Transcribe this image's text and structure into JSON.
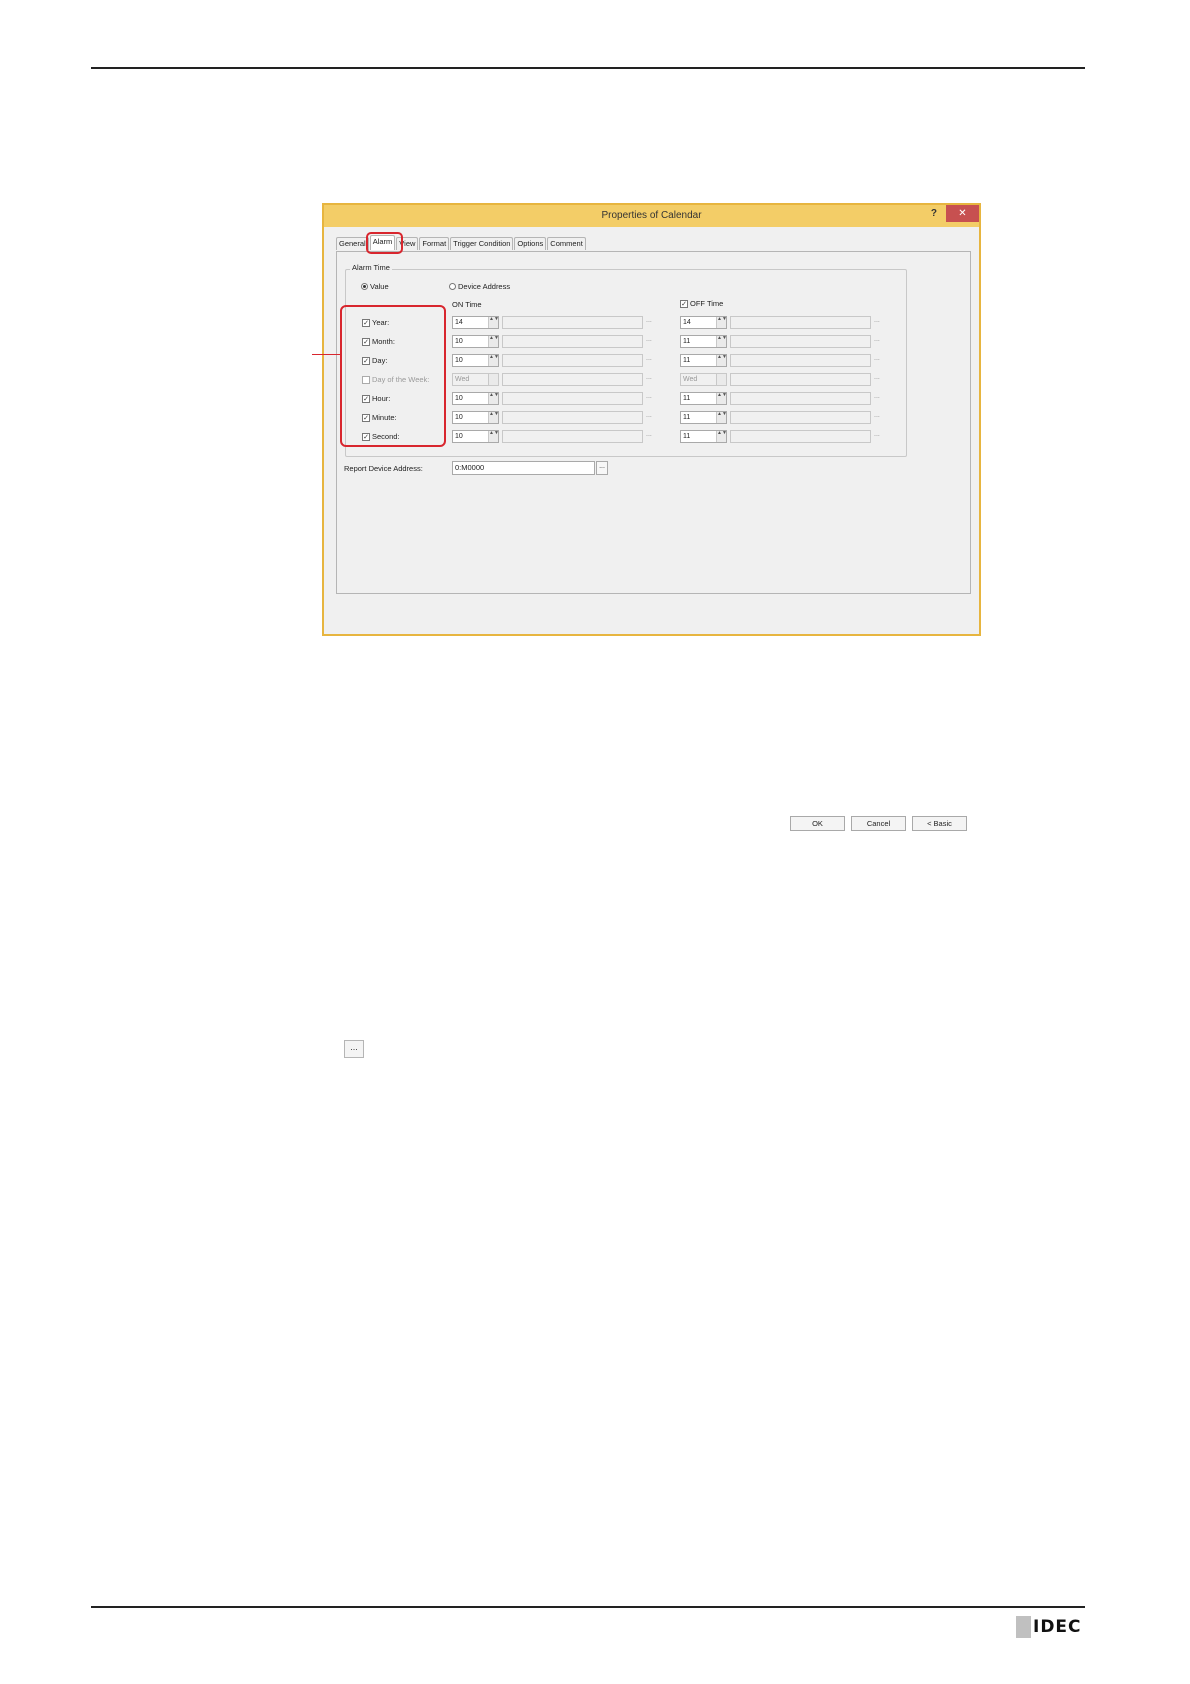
{
  "dialog": {
    "title": "Properties of Calendar",
    "help_label": "?",
    "close_label": "✕",
    "tabs": [
      {
        "label": "General",
        "active": false
      },
      {
        "label": "Alarm",
        "active": true
      },
      {
        "label": "View",
        "active": false
      },
      {
        "label": "Format",
        "active": false
      },
      {
        "label": "Trigger Condition",
        "active": false
      },
      {
        "label": "Options",
        "active": false
      },
      {
        "label": "Comment",
        "active": false
      }
    ],
    "alarm_time": {
      "group_title": "Alarm Time",
      "radio_value": "Value",
      "radio_device_address": "Device Address",
      "selected": "Value",
      "on_time_header": "ON Time",
      "off_time_header": "OFF Time",
      "off_time_checked": true,
      "check_mark": "✓",
      "spin_arrows": "▲▼",
      "ellipsis": "...",
      "rows": [
        {
          "label": "Year:",
          "checked": true,
          "enabled": true,
          "on_value": "14",
          "off_value": "14"
        },
        {
          "label": "Month:",
          "checked": true,
          "enabled": true,
          "on_value": "10",
          "off_value": "11"
        },
        {
          "label": "Day:",
          "checked": true,
          "enabled": true,
          "on_value": "10",
          "off_value": "11"
        },
        {
          "label": "Day of the Week:",
          "checked": false,
          "enabled": false,
          "on_value": "Wed",
          "off_value": "Wed"
        },
        {
          "label": "Hour:",
          "checked": true,
          "enabled": true,
          "on_value": "10",
          "off_value": "11"
        },
        {
          "label": "Minute:",
          "checked": true,
          "enabled": true,
          "on_value": "10",
          "off_value": "11"
        },
        {
          "label": "Second:",
          "checked": true,
          "enabled": true,
          "on_value": "10",
          "off_value": "11"
        }
      ]
    },
    "report_device_address": {
      "label": "Report Device Address:",
      "value": "0:M0000",
      "browse_label": "..."
    },
    "buttons": {
      "ok": "OK",
      "cancel": "Cancel",
      "basic": "< Basic"
    }
  },
  "page": {
    "ellipsis_button_label": "...",
    "brand_logo": "IDEC"
  }
}
